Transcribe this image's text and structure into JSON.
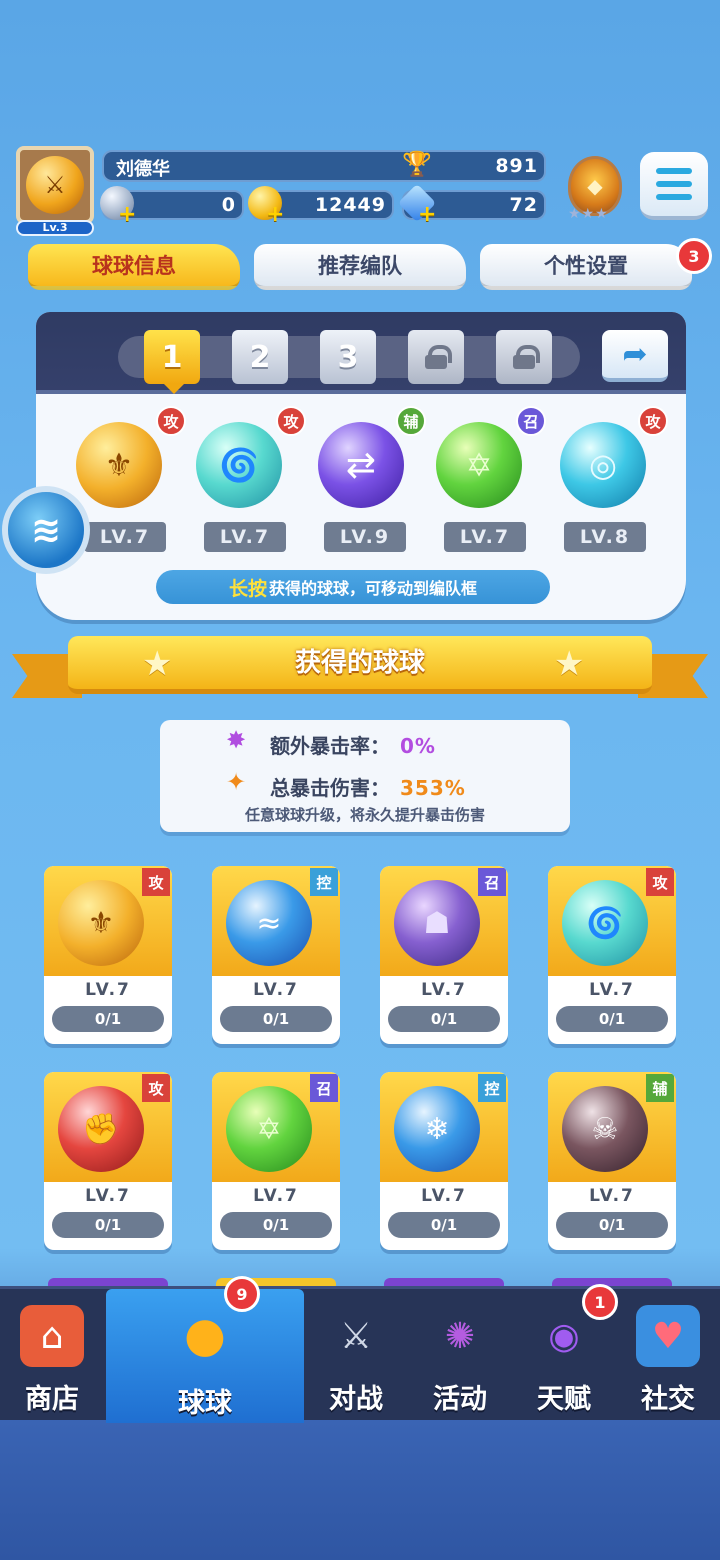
{
  "player": {
    "name": "刘德华",
    "level_label": "Lv.3",
    "trophies": "891",
    "silver": "0",
    "gold": "12449",
    "gems": "72"
  },
  "tabs": [
    {
      "label": "球球信息",
      "active": true
    },
    {
      "label": "推荐编队",
      "active": false
    },
    {
      "label": "个性设置",
      "active": false,
      "badge": "3"
    }
  ],
  "team": {
    "slots": [
      "1",
      "2",
      "3"
    ],
    "selected_slot": "1",
    "balls": [
      {
        "type": "攻",
        "level": "LV.7",
        "color": "gold",
        "icon": "knight-helmet-icon"
      },
      {
        "type": "攻",
        "level": "LV.7",
        "color": "teal",
        "icon": "tornado-icon"
      },
      {
        "type": "辅",
        "level": "LV.9",
        "color": "purple",
        "icon": "swap-arrow-icon"
      },
      {
        "type": "召",
        "level": "LV.7",
        "color": "green",
        "icon": "hexagram-icon"
      },
      {
        "type": "攻",
        "level": "LV.8",
        "color": "cyan",
        "icon": "vortex-icon"
      }
    ],
    "hint_highlight": "长按",
    "hint_text": "获得的球球，可移动到编队框"
  },
  "section_title": "获得的球球",
  "crit": {
    "extra_label": "额外暴击率：",
    "extra_value": "0%",
    "total_label": "总暴击伤害：",
    "total_value": "353%",
    "note": "任意球球升级，将永久提升暴击伤害"
  },
  "owned_balls": [
    {
      "type": "攻",
      "level": "LV.7",
      "progress": "0/1",
      "color": "gold",
      "icon": "knight-helmet-icon"
    },
    {
      "type": "控",
      "level": "LV.7",
      "progress": "0/1",
      "color": "blue",
      "icon": "wave-icon"
    },
    {
      "type": "召",
      "level": "LV.7",
      "progress": "0/1",
      "color": "violet",
      "icon": "ghost-icon"
    },
    {
      "type": "攻",
      "level": "LV.7",
      "progress": "0/1",
      "color": "teal",
      "icon": "tornado-icon"
    },
    {
      "type": "攻",
      "level": "LV.7",
      "progress": "0/1",
      "color": "red",
      "icon": "fist-icon"
    },
    {
      "type": "召",
      "level": "LV.7",
      "progress": "0/1",
      "color": "green",
      "icon": "hexagram-icon"
    },
    {
      "type": "控",
      "level": "LV.7",
      "progress": "0/1",
      "color": "blue",
      "icon": "snowflake-icon"
    },
    {
      "type": "辅",
      "level": "LV.7",
      "progress": "0/1",
      "color": "dark",
      "icon": "skull-icon"
    }
  ],
  "nav": [
    {
      "label": "商店",
      "icon": "shop-icon"
    },
    {
      "label": "球球",
      "icon": "ball-icon",
      "active": true,
      "badge": "9"
    },
    {
      "label": "对战",
      "icon": "crossed-swords-icon"
    },
    {
      "label": "活动",
      "icon": "party-popper-icon"
    },
    {
      "label": "天赋",
      "icon": "planet-icon",
      "badge": "1"
    },
    {
      "label": "社交",
      "icon": "chat-phone-icon"
    }
  ]
}
